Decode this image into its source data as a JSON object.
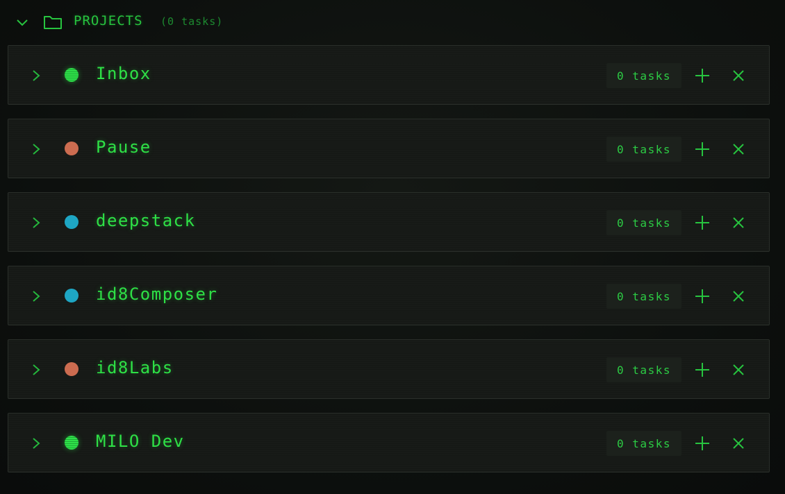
{
  "header": {
    "title": "PROJECTS",
    "count": "(0 tasks)",
    "chevron_icon": "chevron-down-icon",
    "folder_icon": "folder-icon"
  },
  "colors": {
    "primary_green": "#2ee046",
    "dim_green": "#1d8a30",
    "dot_green": "#2fe24a",
    "dot_orange": "#cc6c50",
    "dot_cyan": "#1ea6c4"
  },
  "projects": [
    {
      "name": "Inbox",
      "count": "0 tasks",
      "dot_color": "#2fe24a",
      "add_label": "+",
      "delete_label": "×"
    },
    {
      "name": "Pause",
      "count": "0 tasks",
      "dot_color": "#cc6c50",
      "add_label": "+",
      "delete_label": "×"
    },
    {
      "name": "deepstack",
      "count": "0 tasks",
      "dot_color": "#1ea6c4",
      "add_label": "+",
      "delete_label": "×"
    },
    {
      "name": "id8Composer",
      "count": "0 tasks",
      "dot_color": "#1ea6c4",
      "add_label": "+",
      "delete_label": "×"
    },
    {
      "name": "id8Labs",
      "count": "0 tasks",
      "dot_color": "#cc6c50",
      "add_label": "+",
      "delete_label": "×"
    },
    {
      "name": "MILO Dev",
      "count": "0 tasks",
      "dot_color": "#2fe24a",
      "add_label": "+",
      "delete_label": "×"
    }
  ]
}
